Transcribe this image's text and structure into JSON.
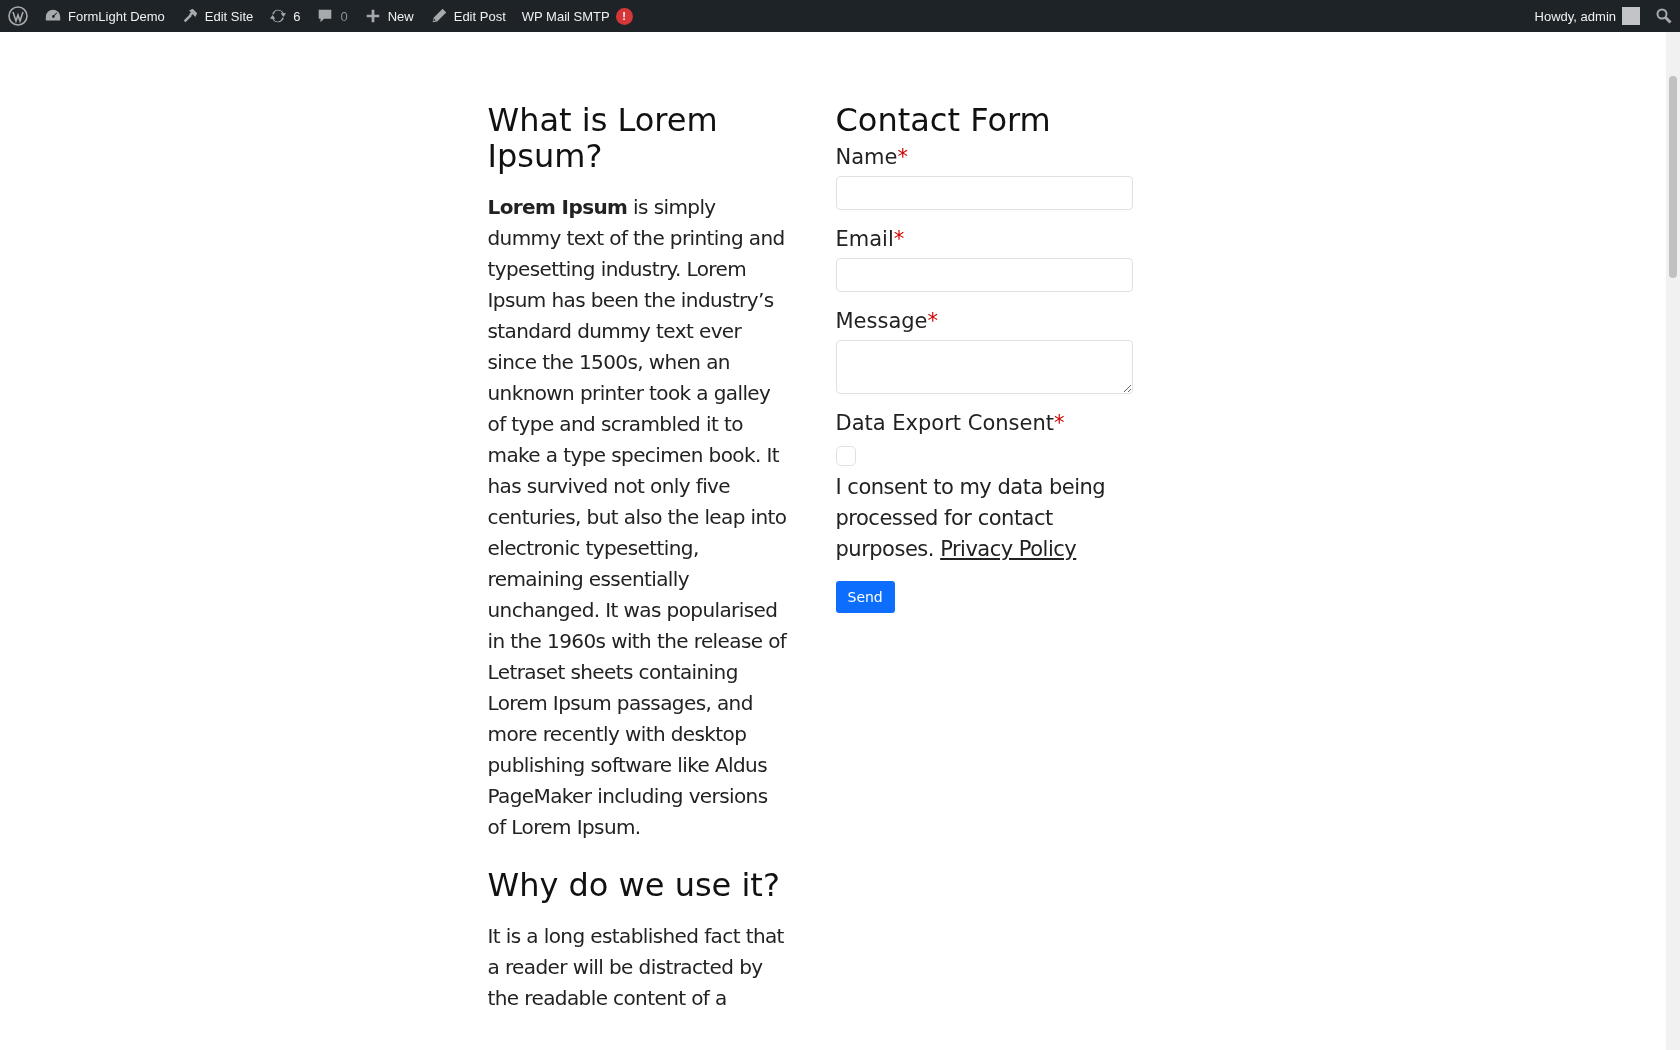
{
  "admin_bar": {
    "items": [
      {
        "kind": "logo"
      },
      {
        "kind": "site",
        "label": "FormLight Demo"
      },
      {
        "kind": "edit_site",
        "label": "Edit Site"
      },
      {
        "kind": "updates",
        "label": "6"
      },
      {
        "kind": "comments",
        "label": "0"
      },
      {
        "kind": "new",
        "label": "New"
      },
      {
        "kind": "edit_post",
        "label": "Edit Post"
      },
      {
        "kind": "smtp",
        "label": "WP Mail SMTP",
        "badge": "!"
      }
    ],
    "account": {
      "label": "Howdy, admin"
    }
  },
  "article": [
    {
      "kind": "heading",
      "text": "What is Lorem Ipsum?"
    },
    {
      "kind": "paragraph",
      "text": "**Lorem Ipsum** is simply dummy text of the printing and typesetting industry. Lorem Ipsum has been the industry’s standard dummy text ever since the 1500s, when an unknown printer took a galley of type and scrambled it to make a type specimen book. It has survived not only five centuries, but also the leap into electronic typesetting, remaining essentially unchanged. It was popularised in the 1960s with the release of Letraset sheets containing Lorem Ipsum passages, and more recently with desktop publishing software like Aldus PageMaker including versions of Lorem Ipsum."
    },
    {
      "kind": "heading",
      "text": "Why do we use it?"
    },
    {
      "kind": "paragraph",
      "text": "It is a long established fact that a reader will be distracted by the readable content of a"
    }
  ],
  "contact_form": {
    "title": "Contact Form",
    "fields": [
      {
        "kind": "text",
        "label": "Name",
        "required": "*"
      },
      {
        "kind": "text",
        "label": "Email",
        "required": "*"
      },
      {
        "kind": "textarea",
        "label": "Message",
        "required": "*"
      },
      {
        "kind": "checkbox",
        "label": "Data Export Consent",
        "required": "*",
        "checked": false,
        "consent_text": "I consent to my data being processed for contact purposes.",
        "link": "Privacy Policy"
      }
    ],
    "submit": "Send"
  }
}
